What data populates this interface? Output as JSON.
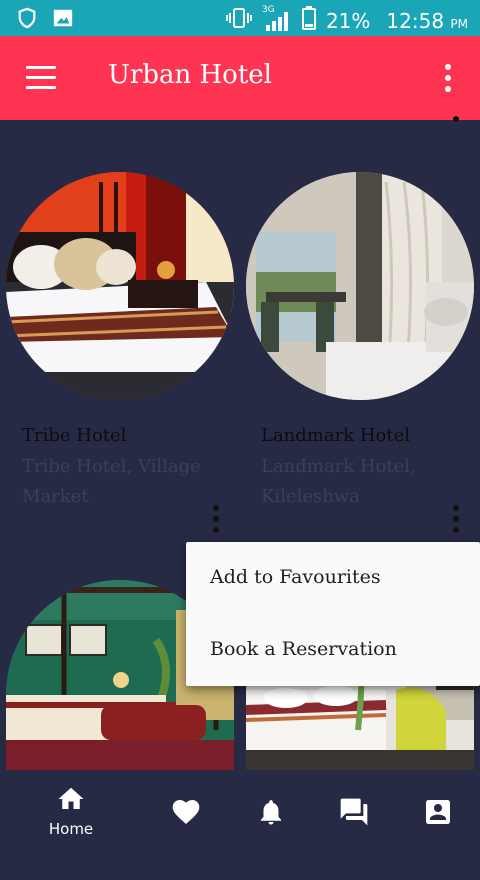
{
  "status_bar": {
    "network": "3G",
    "battery": "21%",
    "time": "12:58",
    "ampm": "PM",
    "icons": [
      "shield-icon",
      "image-icon",
      "vibrate-icon",
      "signal-icon",
      "battery-icon"
    ]
  },
  "app_bar": {
    "title": "Urban Hotel",
    "icons": [
      "menu-icon",
      "more-vert-icon"
    ]
  },
  "hotels": [
    {
      "name": "Tribe Hotel",
      "address": "Tribe Hotel, Village Market"
    },
    {
      "name": "Landmark Hotel",
      "address": "Landmark Hotel, Kileleshwa"
    }
  ],
  "popup_menu": {
    "items": [
      "Add to Favourites",
      "Book a Reservation"
    ]
  },
  "bottom_nav": {
    "home_label": "Home",
    "icons": [
      "home-icon",
      "heart-icon",
      "bell-icon",
      "chat-icon",
      "account-icon"
    ]
  },
  "colors": {
    "status_bar": "#1aa6b7",
    "app_bar": "#fe3452",
    "background": "#262a44",
    "popup": "#fafafa"
  }
}
